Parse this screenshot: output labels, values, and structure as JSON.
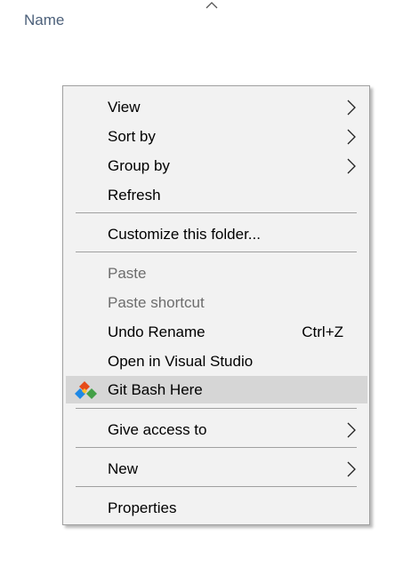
{
  "header": {
    "name_label": "Name"
  },
  "icons": {
    "sort": "chevron-up-icon",
    "submenu": "chevron-right-icon",
    "git": "git-bash-icon"
  },
  "colors": {
    "menu_background": "#f2f2f2",
    "hover": "#d6d6d6",
    "disabled_text": "#6d6d6d",
    "separator": "#a0a0a0",
    "header_text": "#4c607a"
  },
  "menu": {
    "items": [
      {
        "label": "View",
        "submenu": true
      },
      {
        "label": "Sort by",
        "submenu": true
      },
      {
        "label": "Group by",
        "submenu": true
      },
      {
        "label": "Refresh"
      },
      {
        "label": "Customize this folder..."
      },
      {
        "label": "Paste",
        "disabled": true
      },
      {
        "label": "Paste shortcut",
        "disabled": true
      },
      {
        "label": "Undo Rename",
        "shortcut": "Ctrl+Z"
      },
      {
        "label": "Open in Visual Studio"
      },
      {
        "label": "Git Bash Here",
        "highlighted": true,
        "icon": "git-bash-icon"
      },
      {
        "label": "Give access to",
        "submenu": true
      },
      {
        "label": "New",
        "submenu": true
      },
      {
        "label": "Properties"
      }
    ]
  }
}
